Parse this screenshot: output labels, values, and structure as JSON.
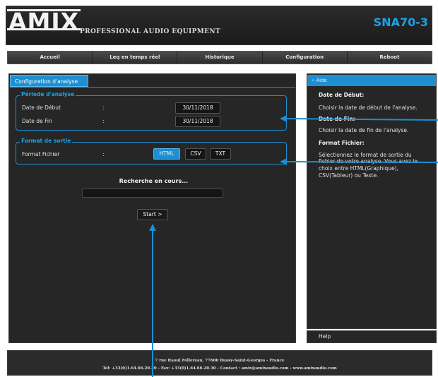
{
  "header": {
    "logo_text": "AMIX",
    "tagline": "PROFESSIONAL AUDIO EQUIPMENT",
    "product": "SNA70-3"
  },
  "nav": {
    "items": [
      {
        "label": "Accueil"
      },
      {
        "label": "Leq en temps réel"
      },
      {
        "label": "Historique"
      },
      {
        "label": "Configuration"
      },
      {
        "label": "Reboot"
      }
    ]
  },
  "main": {
    "tab_label": "Configuration d'analyse",
    "periode": {
      "legend": "Période d'analyse",
      "debut_label": "Date de Début",
      "debut_value": "30/11/2018",
      "fin_label": "Date de Fin",
      "fin_value": "30/11/2018",
      "colon": ":"
    },
    "format": {
      "legend": "Format de sortie",
      "label": "Format Fichier",
      "colon": ":",
      "options": [
        "HTML",
        "CSV",
        "TXT"
      ],
      "selected": "HTML"
    },
    "search_title": "Recherche en cours...",
    "start_label": "Start >"
  },
  "help": {
    "header": "Aide",
    "debut_title": "Date de Début:",
    "debut_text": "Choisir la date de début de l'analyse.",
    "fin_title": "Date de Fin:",
    "fin_text": "Choisir la date de fin de l'analyse.",
    "format_title": "Format Fichier:",
    "format_text_1": "Sélectionnez le format de sortie du",
    "format_text_2": "fichier de votre analyse. Vous avez le",
    "format_text_3": "choix entre HTML(Graphique),",
    "format_text_4": "CSV(Tableur) ou Texte.",
    "footer_label": "Help"
  },
  "footer": {
    "address": "7 rue Raoul Follereau, 77600 Bussy-Saint-Georges - France",
    "contact": "Tel: +33(0)1.64.66.20.20 - Fax: +33(0)1.64.66.20.30 - Contact : amix@amixaudio.com - www.amixaudio.com"
  },
  "colors": {
    "accent": "#1e8fd0",
    "product": "#1aa3e8",
    "panel": "#262626"
  }
}
